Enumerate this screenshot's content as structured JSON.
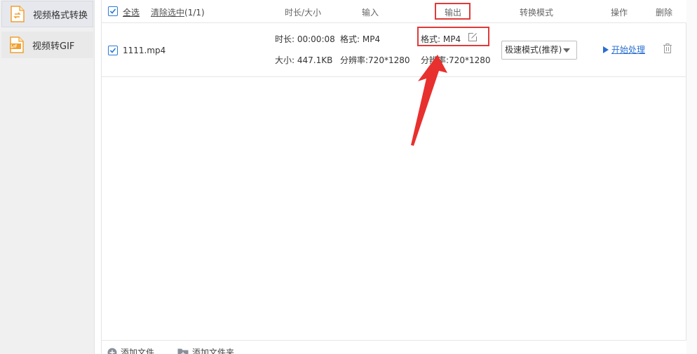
{
  "sidebar": {
    "items": [
      {
        "label": "视频格式转换",
        "icon": "convert-file-icon"
      },
      {
        "label": "视频转GIF",
        "icon": "gif-file-icon"
      }
    ]
  },
  "header": {
    "select_all": "全选",
    "clear_selection": "清除选中",
    "selection_count": "(1/1)",
    "col_duration_size": "时长/大小",
    "col_input": "输入",
    "col_output": "输出",
    "col_mode": "转换模式",
    "col_action": "操作",
    "col_delete": "删除"
  },
  "file": {
    "name": "1111.mp4",
    "duration": "时长: 00:00:08",
    "size": "大小: 447.1KB",
    "input_format": "格式: MP4",
    "input_resolution": "分辨率:720*1280",
    "output_format": "格式: MP4",
    "output_resolution": "分辨率:720*1280",
    "mode": "极速模式(推荐)",
    "action": "开始处理"
  },
  "footer": {
    "add_file": "添加文件",
    "add_folder": "添加文件夹"
  },
  "colors": {
    "accent": "#2a6fd1",
    "highlight": "#e03a3a",
    "icon_orange": "#f0a030"
  }
}
